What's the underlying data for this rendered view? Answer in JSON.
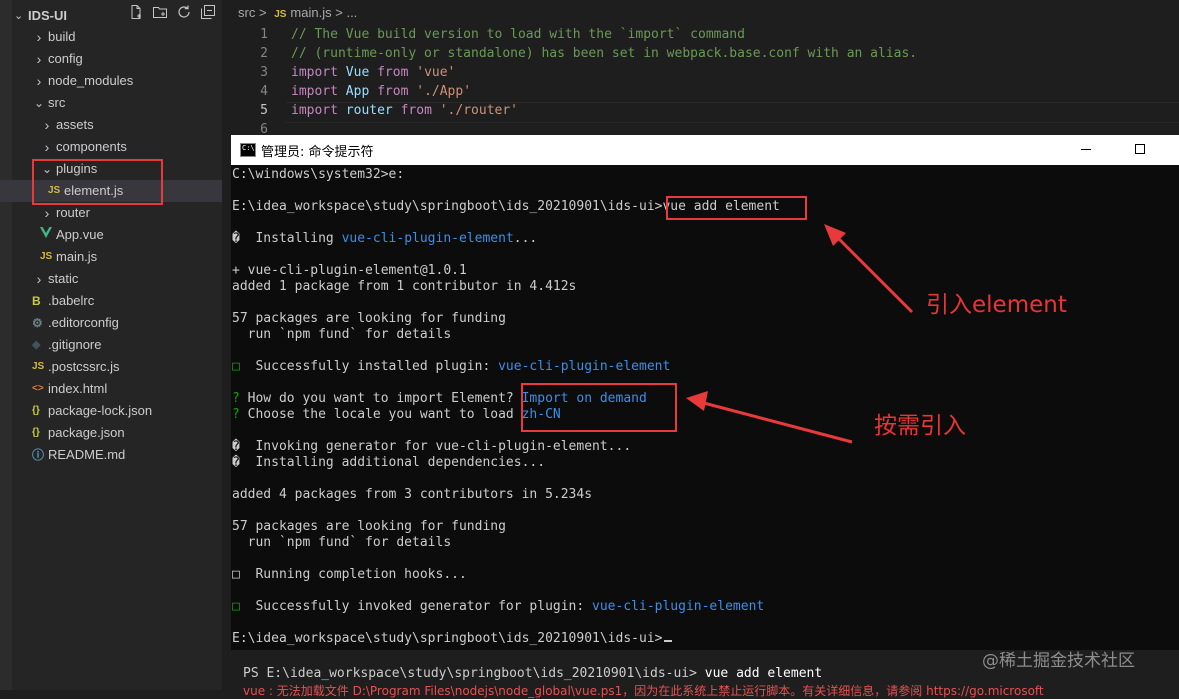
{
  "explorer": {
    "title": "IDS-UI",
    "tree": [
      {
        "label": "build",
        "type": "folder",
        "open": false,
        "depth": 0
      },
      {
        "label": "config",
        "type": "folder",
        "open": false,
        "depth": 0
      },
      {
        "label": "node_modules",
        "type": "folder",
        "open": false,
        "depth": 0
      },
      {
        "label": "src",
        "type": "folder",
        "open": true,
        "depth": 0
      },
      {
        "label": "assets",
        "type": "folder",
        "open": false,
        "depth": 1
      },
      {
        "label": "components",
        "type": "folder",
        "open": false,
        "depth": 1
      },
      {
        "label": "plugins",
        "type": "folder",
        "open": true,
        "depth": 1
      },
      {
        "label": "element.js",
        "type": "js",
        "depth": 2,
        "selected": true
      },
      {
        "label": "router",
        "type": "folder",
        "open": false,
        "depth": 1
      },
      {
        "label": "App.vue",
        "type": "vue",
        "depth": 1
      },
      {
        "label": "main.js",
        "type": "js",
        "depth": 1
      },
      {
        "label": "static",
        "type": "folder",
        "open": false,
        "depth": 0
      },
      {
        "label": ".babelrc",
        "type": "babel",
        "depth": 0
      },
      {
        "label": ".editorconfig",
        "type": "gear",
        "depth": 0
      },
      {
        "label": ".gitignore",
        "type": "git",
        "depth": 0
      },
      {
        "label": ".postcssrc.js",
        "type": "js",
        "depth": 0
      },
      {
        "label": "index.html",
        "type": "html",
        "depth": 0
      },
      {
        "label": "package-lock.json",
        "type": "json",
        "depth": 0
      },
      {
        "label": "package.json",
        "type": "json",
        "depth": 0
      },
      {
        "label": "README.md",
        "type": "info",
        "depth": 0
      }
    ]
  },
  "icons": {
    "js": "JS",
    "json": "{}"
  },
  "breadcrumb": {
    "folder": "src",
    "sep": ">",
    "file": "main.js",
    "tail": "..."
  },
  "code": [
    {
      "n": "1",
      "parts": [
        [
          "c-com",
          "// The Vue build version to load with the `import` command"
        ]
      ]
    },
    {
      "n": "2",
      "parts": [
        [
          "c-com",
          "// (runtime-only or standalone) has been set in webpack.base.conf with an alias."
        ]
      ]
    },
    {
      "n": "3",
      "parts": [
        [
          "c-kw",
          "import "
        ],
        [
          "c-id",
          "Vue "
        ],
        [
          "c-kw",
          "from "
        ],
        [
          "c-str",
          "'vue'"
        ]
      ]
    },
    {
      "n": "4",
      "parts": [
        [
          "c-kw",
          "import "
        ],
        [
          "c-id",
          "App "
        ],
        [
          "c-kw",
          "from "
        ],
        [
          "c-str",
          "'./App'"
        ]
      ]
    },
    {
      "n": "5",
      "parts": [
        [
          "c-kw",
          "import "
        ],
        [
          "c-id",
          "router "
        ],
        [
          "c-kw",
          "from "
        ],
        [
          "c-str",
          "'./router'"
        ]
      ]
    },
    {
      "n": "6",
      "parts": []
    }
  ],
  "cmd": {
    "title": "管理员: 命令提示符",
    "icon_text": "C:\\",
    "lines": [
      [
        [
          "",
          "C:\\windows\\system32>e:"
        ]
      ],
      [],
      [
        [
          "",
          "E:\\idea_workspace\\study\\springboot\\ids_20210901\\ids-ui>vue add element"
        ]
      ],
      [],
      [
        [
          "",
          "�  Installing "
        ],
        [
          "blue",
          "vue-cli-plugin-element"
        ],
        [
          "",
          "..."
        ]
      ],
      [],
      [
        [
          "",
          "+ vue-cli-plugin-element@1.0.1"
        ]
      ],
      [
        [
          "",
          "added 1 package from 1 contributor in 4.412s"
        ]
      ],
      [],
      [
        [
          "",
          "57 packages are looking for funding"
        ]
      ],
      [
        [
          "",
          "  run `npm fund` for details"
        ]
      ],
      [],
      [
        [
          "green",
          "□"
        ],
        [
          "",
          "  Successfully installed plugin: "
        ],
        [
          "blue",
          "vue-cli-plugin-element"
        ]
      ],
      [],
      [
        [
          "green",
          "?"
        ],
        [
          "",
          " How do you want to import Element? "
        ],
        [
          "blue",
          "Import on demand"
        ]
      ],
      [
        [
          "green",
          "?"
        ],
        [
          "",
          " Choose the locale you want to load "
        ],
        [
          "blue",
          "zh-CN"
        ]
      ],
      [],
      [
        [
          "",
          "�  Invoking generator for vue-cli-plugin-element..."
        ]
      ],
      [
        [
          "",
          "�  Installing additional dependencies..."
        ]
      ],
      [],
      [
        [
          "",
          "added 4 packages from 3 contributors in 5.234s"
        ]
      ],
      [],
      [
        [
          "",
          "57 packages are looking for funding"
        ]
      ],
      [
        [
          "",
          "  run `npm fund` for details"
        ]
      ],
      [],
      [
        [
          "",
          "□  Running completion hooks..."
        ]
      ],
      [],
      [
        [
          "green",
          "□"
        ],
        [
          "",
          "  Successfully invoked generator for plugin: "
        ],
        [
          "blue",
          "vue-cli-plugin-element"
        ]
      ],
      [],
      [
        [
          "",
          "E:\\idea_workspace\\study\\springboot\\ids_20210901\\ids-ui>"
        ]
      ]
    ]
  },
  "annotations": {
    "import_element": "引入element",
    "on_demand": "按需引入"
  },
  "terminal": {
    "prompt": "PS E:\\idea_workspace\\study\\springboot\\ids_20210901\\ids-ui> ",
    "command": "vue add element",
    "error": "vue : 无法加载文件 D:\\Program Files\\nodejs\\node_global\\vue.ps1，因为在此系统上禁止运行脚本。有关详细信息，请参阅 https://go.microsoft"
  },
  "watermark": "@稀土掘金技术社区",
  "colors": {
    "annotation": "#e8393b",
    "js_icon": "#d7ba3d",
    "vue_icon": "#41b883",
    "json_icon": "#cbcb41"
  }
}
